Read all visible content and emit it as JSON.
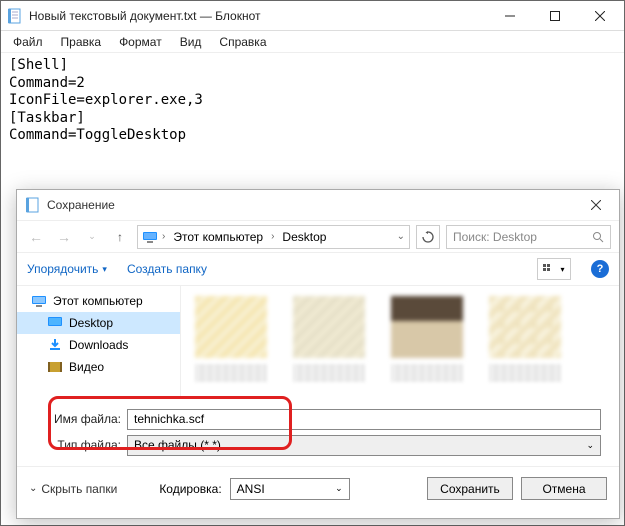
{
  "notepad": {
    "title": "Новый текстовый документ.txt — Блокнот",
    "menu": {
      "file": "Файл",
      "edit": "Правка",
      "format": "Формат",
      "view": "Вид",
      "help": "Справка"
    },
    "content": "[Shell]\nCommand=2\nIconFile=explorer.exe,3\n[Taskbar]\nCommand=ToggleDesktop"
  },
  "dialog": {
    "title": "Сохранение",
    "breadcrumb": {
      "root_sep": "›",
      "pc": "Этот компьютер",
      "sep": "›",
      "loc": "Desktop"
    },
    "search_placeholder": "Поиск: Desktop",
    "toolbar": {
      "organize": "Упорядочить",
      "new_folder": "Создать папку"
    },
    "tree": {
      "this_pc": "Этот компьютер",
      "desktop": "Desktop",
      "downloads": "Downloads",
      "videos": "Видео"
    },
    "filename_label": "Имя файла:",
    "filename_value": "tehnichka.scf",
    "filetype_label": "Тип файла:",
    "filetype_value": "Все файлы  (*.*)",
    "hide_folders": "Скрыть папки",
    "encoding_label": "Кодировка:",
    "encoding_value": "ANSI",
    "save_btn": "Сохранить",
    "cancel_btn": "Отмена"
  }
}
